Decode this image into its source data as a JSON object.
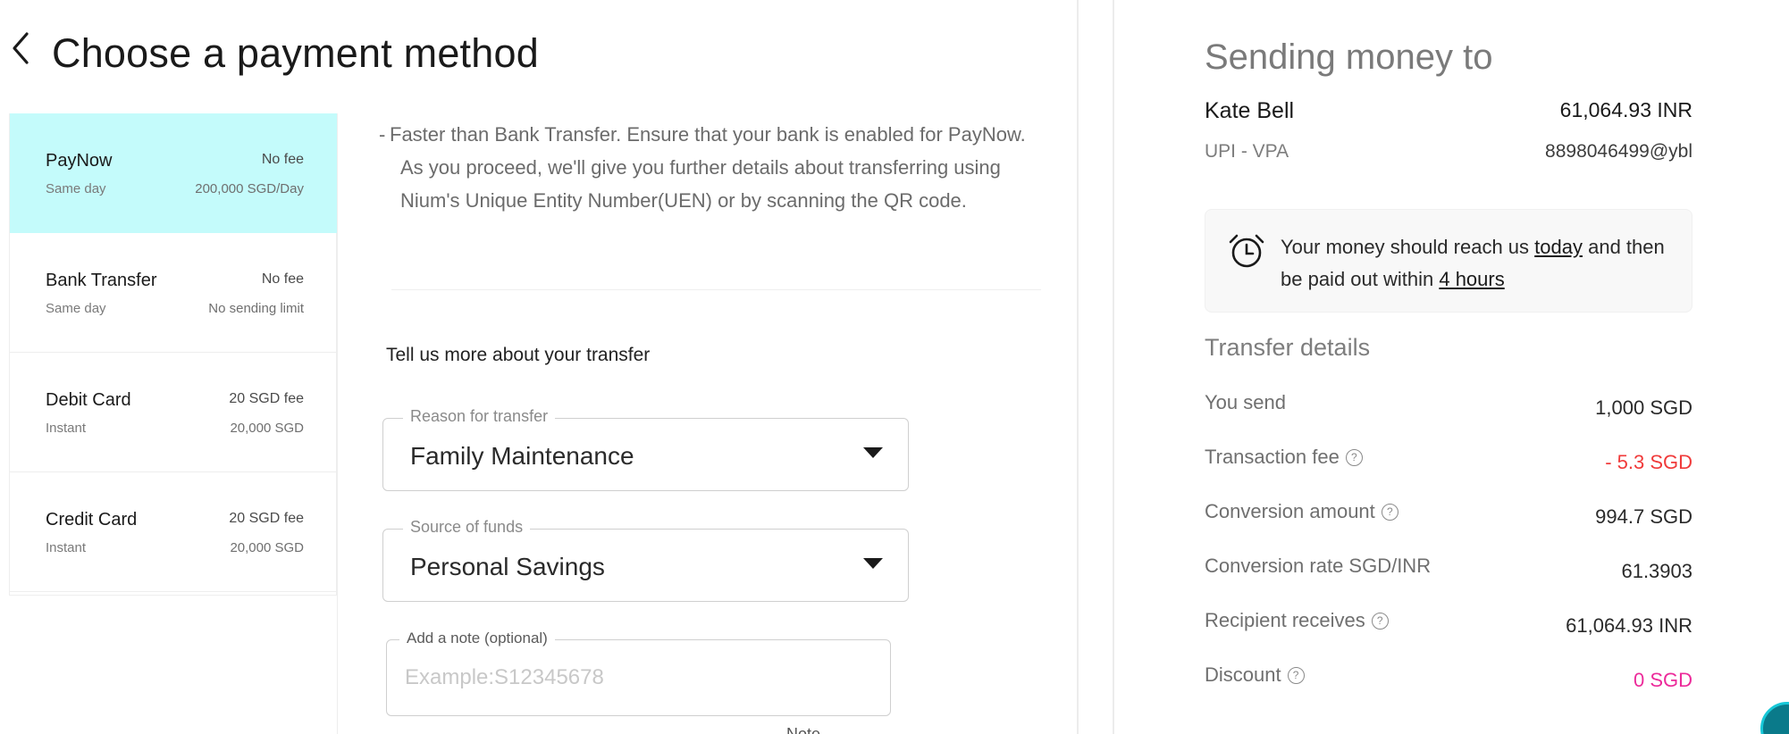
{
  "header": {
    "title": "Choose a payment method"
  },
  "payment_methods": [
    {
      "name": "PayNow",
      "speed": "Same day",
      "fee": "No fee",
      "limit": "200,000 SGD/Day",
      "selected": true
    },
    {
      "name": "Bank Transfer",
      "speed": "Same day",
      "fee": "No fee",
      "limit": "No sending limit",
      "selected": false
    },
    {
      "name": "Debit Card",
      "speed": "Instant",
      "fee": "20 SGD fee",
      "limit": "20,000 SGD",
      "selected": false
    },
    {
      "name": "Credit Card",
      "speed": "Instant",
      "fee": "20 SGD fee",
      "limit": "20,000 SGD",
      "selected": false
    }
  ],
  "description": {
    "dash": "-",
    "text": "Faster than Bank Transfer. Ensure that your bank is enabled for PayNow. As you proceed, we'll give you further details about transferring using Nium's Unique Entity Number(UEN) or by scanning the QR code."
  },
  "transfer_form": {
    "section_label": "Tell us more about your transfer",
    "reason": {
      "label": "Reason for transfer",
      "value": "Family Maintenance"
    },
    "source": {
      "label": "Source of funds",
      "value": "Personal Savings"
    },
    "note": {
      "label": "Add a note (optional)",
      "placeholder": "Example:S12345678",
      "value": ""
    },
    "cut_off_text": "Note"
  },
  "summary": {
    "title": "Sending money to",
    "recipient_name": "Kate Bell",
    "recipient_amount": "61,064.93 INR",
    "recipient_method": "UPI - VPA",
    "recipient_account": "8898046499@ybl",
    "timing": {
      "prefix": "Your money should reach us ",
      "when_received": "today",
      "middle": " and then be paid out within ",
      "payout_time": "4 hours"
    },
    "details_title": "Transfer details",
    "details": [
      {
        "label": "You send",
        "value": "1,000 SGD",
        "info": false,
        "tone": "normal"
      },
      {
        "label": "Transaction fee",
        "value": "- 5.3 SGD",
        "info": true,
        "tone": "red"
      },
      {
        "label": "Conversion amount",
        "value": "994.7 SGD",
        "info": true,
        "tone": "normal"
      },
      {
        "label": "Conversion rate SGD/INR",
        "value": "61.3903",
        "info": false,
        "tone": "normal"
      },
      {
        "label": "Recipient receives",
        "value": "61,064.93 INR",
        "info": true,
        "tone": "normal"
      },
      {
        "label": "Discount",
        "value": "0 SGD",
        "info": true,
        "tone": "pink"
      }
    ]
  },
  "icons": {
    "back": "chevron-left-icon",
    "dropdown": "caret-down-icon",
    "info": "info-circle-icon",
    "info_glyph": "?",
    "alarm": "alarm-clock-icon"
  },
  "colors": {
    "selected_method_bg": "#c4fbfb",
    "fee_negative": "#f03a3a",
    "discount": "#ec2a9a",
    "chat_accent": "#17c8d8"
  }
}
